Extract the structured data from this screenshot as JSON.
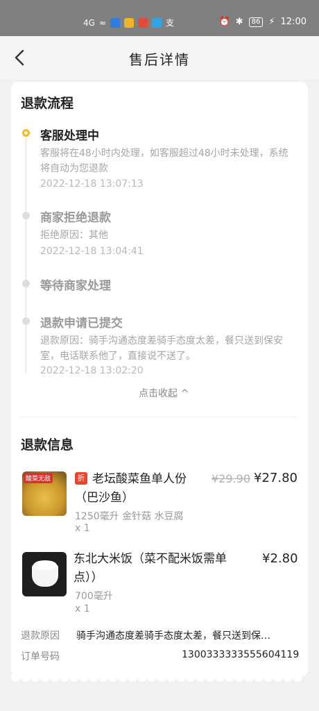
{
  "status_bar": {
    "signal": "4G",
    "battery": "86",
    "time": "12:00",
    "alipay_glyph": "支"
  },
  "header": {
    "title": "售后详情"
  },
  "refund_flow": {
    "title": "退款流程",
    "steps": [
      {
        "title": "客服处理中",
        "desc": "客服将在48小时内处理，如客服超过48小时未处理，系统将自动为您退款",
        "time": "2022-12-18 13:07:13"
      },
      {
        "title": "商家拒绝退款",
        "desc": "拒绝原因：其他",
        "time": "2022-12-18 13:04:41"
      },
      {
        "title": "等待商家处理"
      },
      {
        "title": "退款申请已提交",
        "desc": "退款原因：骑手沟通态度差骑手态度太差，餐只送到保安室，电话联系他了，直接说不送了。",
        "time": "2022-12-18 13:02:20"
      }
    ],
    "collapse_label": "点击收起 ^"
  },
  "refund_info": {
    "title": "退款信息",
    "items": [
      {
        "badge": "折",
        "thumb_tag": "酸菜无敌",
        "name": "老坛酸菜鱼单人份（巴沙鱼）",
        "spec": "1250毫升 金针菇 水豆腐",
        "qty": "x 1",
        "price_old": "¥29.90",
        "price": "¥27.80"
      },
      {
        "name": "东北大米饭（菜不配米饭需单点））",
        "spec": "700毫升",
        "qty": "x 1",
        "price": "¥2.80"
      }
    ],
    "reason_label": "退款原因",
    "reason_value": "骑手沟通态度差骑手态度太差，餐只送到保…",
    "order_label": "订单号码",
    "order_value": "1300333333555604119"
  }
}
